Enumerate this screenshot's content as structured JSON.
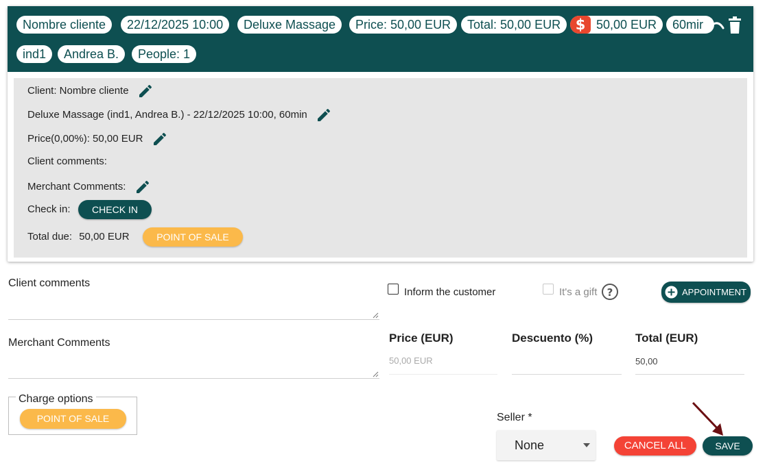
{
  "header": {
    "chips": {
      "client": "Nombre cliente",
      "datetime": "22/12/2025 10:00",
      "service": "Deluxe Massage",
      "price": "Price: 50,00 EUR",
      "total": "Total: 50,00 EUR",
      "paid": "50,00 EUR",
      "duration": "60mir",
      "resource": "ind1",
      "staff": "Andrea B.",
      "people": "People: 1"
    },
    "icons": {
      "money": "dollar-icon",
      "trash": "trash-icon"
    }
  },
  "details": {
    "client": "Client: Nombre cliente",
    "service": "Deluxe Massage (ind1, Andrea B.) - 22/12/2025 10:00, 60min",
    "price": "Price(0,00%): 50,00 EUR",
    "client_comments": "Client comments:",
    "merchant_comments": "Merchant Comments:",
    "checkin_label": "Check in:",
    "checkin_button": "CHECK IN",
    "total_due_label": "Total due:",
    "total_due_value": "50,00 EUR",
    "pos_button": "POINT OF SALE"
  },
  "form": {
    "client_comments_label": "Client comments",
    "merchant_comments_label": "Merchant Comments",
    "inform_customer": "Inform the customer",
    "gift": "It's a gift",
    "appointment_button": "APPOINTMENT",
    "price_head": "Price (EUR)",
    "discount_head": "Descuento (%)",
    "total_head": "Total (EUR)",
    "price_value": "50,00 EUR",
    "total_value": "50,00",
    "charge_options_legend": "Charge options",
    "charge_pos_button": "POINT OF SALE",
    "seller_label": "Seller *",
    "seller_value": "None",
    "cancel_button": "CANCEL ALL",
    "save_button": "SAVE"
  },
  "colors": {
    "teal": "#0e4f51",
    "yellow": "#fbb94a",
    "red": "#f44336",
    "money_red": "#e8472e",
    "arrow": "#6b0f12"
  }
}
